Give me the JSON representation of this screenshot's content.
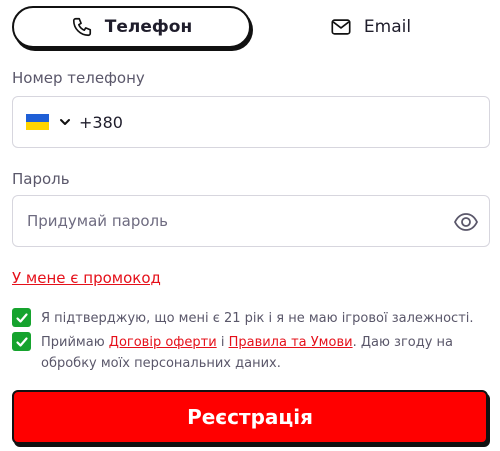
{
  "tabs": {
    "phone": {
      "label": "Телефон",
      "icon": "phone-icon"
    },
    "email": {
      "label": "Email",
      "icon": "envelope-icon"
    }
  },
  "phone_field": {
    "label": "Номер телефону",
    "country_flag": "ukraine-flag-icon",
    "code": "+380"
  },
  "password_field": {
    "label": "Пароль",
    "placeholder": "Придумай пароль",
    "toggle_icon": "eye-icon"
  },
  "promo_link": "У мене є промокод",
  "consents": {
    "age": {
      "checked": true,
      "text": "Я підтверджую, що мені є 21 рік і я не маю ігрової залежності."
    },
    "terms": {
      "checked": true,
      "prefix": "Приймаю ",
      "offer_link": "Договір оферти",
      "conjunction": " і ",
      "rules_link": "Правила та Умови",
      "suffix": ". Даю згоду на обробку моїх персональних даних."
    }
  },
  "register_button": "Реєстрація",
  "colors": {
    "accent_red": "#ff0000",
    "link_red": "#e5101a",
    "check_green": "#16a32e",
    "flag_blue": "#1f5fd6",
    "flag_yellow": "#ffd500"
  }
}
